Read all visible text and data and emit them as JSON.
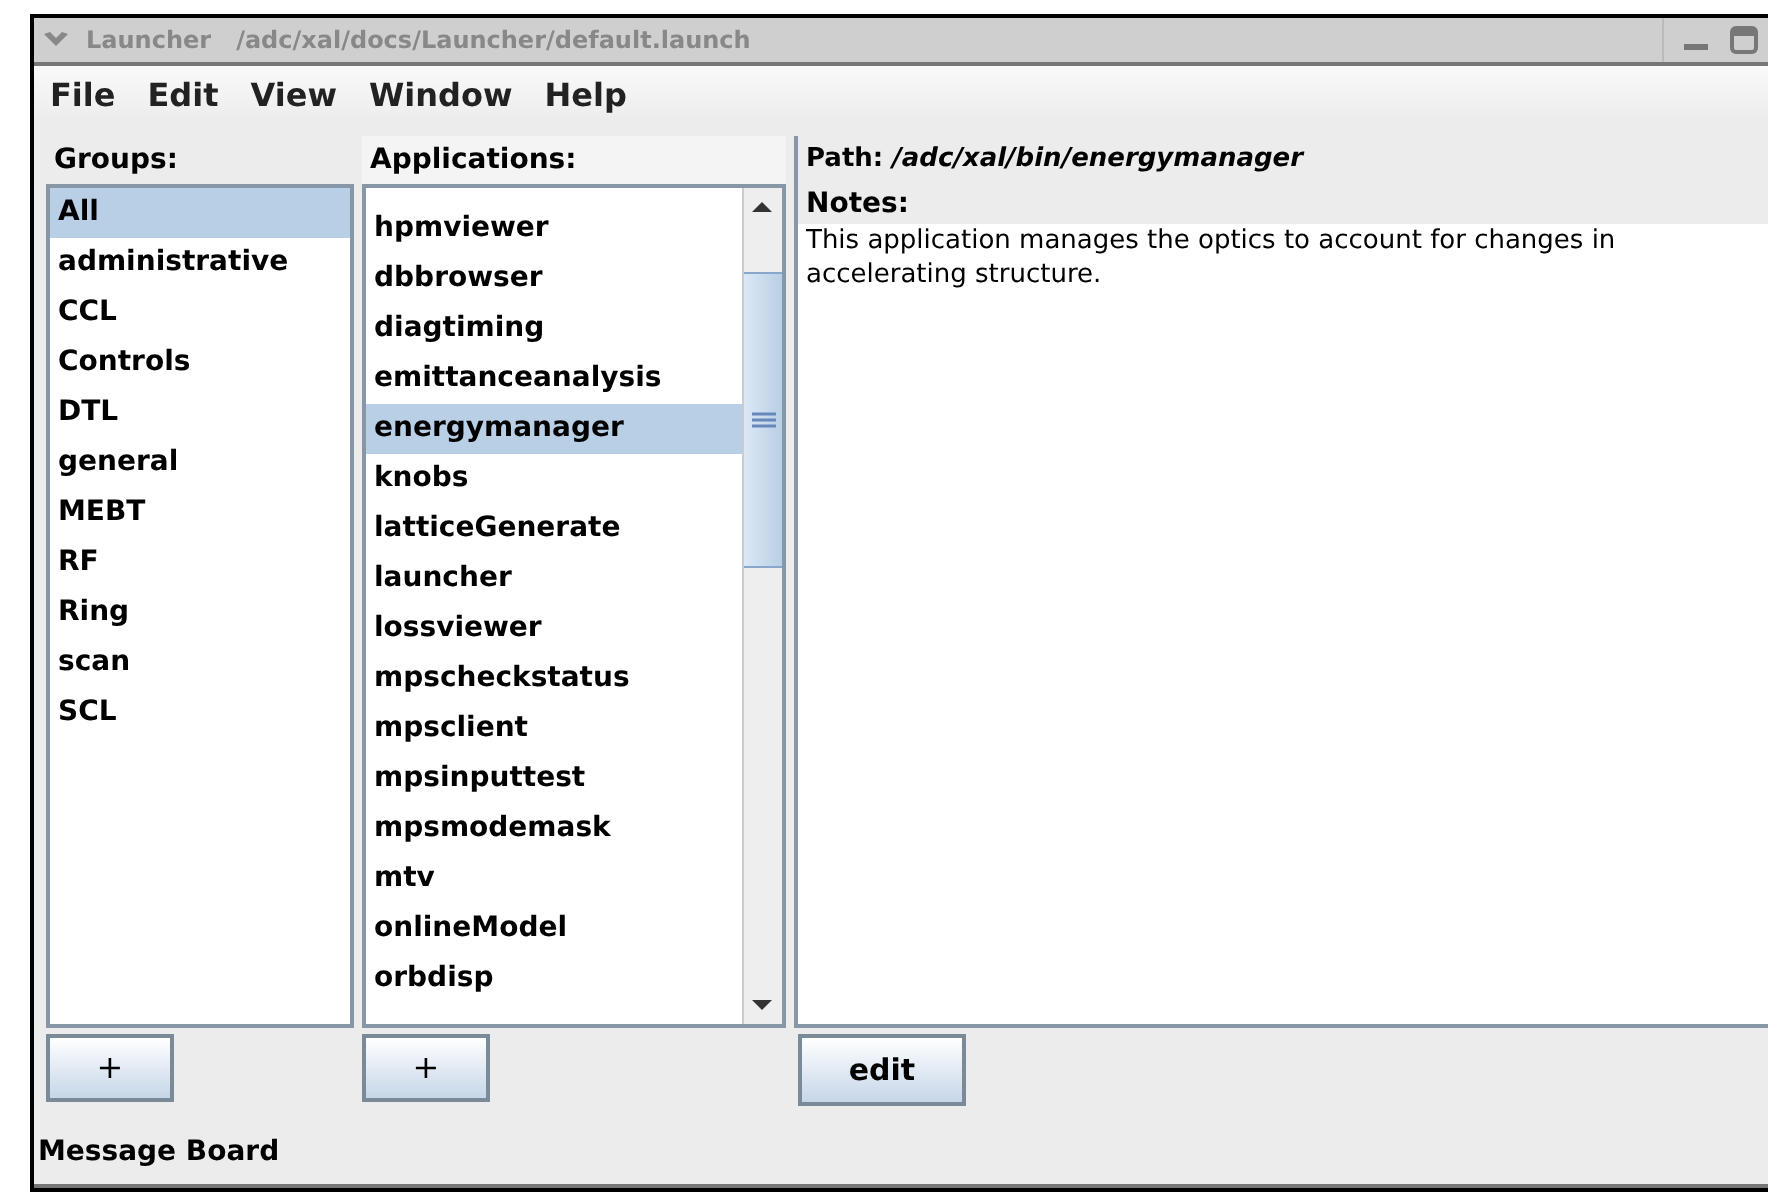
{
  "window": {
    "title": "Launcher   /adc/xal/docs/Launcher/default.launch"
  },
  "menu": [
    "File",
    "Edit",
    "View",
    "Window",
    "Help"
  ],
  "groups": {
    "heading": "Groups:",
    "items": [
      {
        "label": "All",
        "selected": true
      },
      {
        "label": "administrative",
        "selected": false
      },
      {
        "label": "CCL",
        "selected": false
      },
      {
        "label": "Controls",
        "selected": false
      },
      {
        "label": "DTL",
        "selected": false
      },
      {
        "label": "general",
        "selected": false
      },
      {
        "label": "MEBT",
        "selected": false
      },
      {
        "label": "RF",
        "selected": false
      },
      {
        "label": "Ring",
        "selected": false
      },
      {
        "label": "scan",
        "selected": false
      },
      {
        "label": "SCL",
        "selected": false
      }
    ],
    "add_button": "+"
  },
  "applications": {
    "heading": "Applications:",
    "items": [
      {
        "label": "hpmviewer",
        "selected": false
      },
      {
        "label": "dbbrowser",
        "selected": false
      },
      {
        "label": "diagtiming",
        "selected": false
      },
      {
        "label": "emittanceanalysis",
        "selected": false
      },
      {
        "label": "energymanager",
        "selected": true
      },
      {
        "label": "knobs",
        "selected": false
      },
      {
        "label": "latticeGenerate",
        "selected": false
      },
      {
        "label": "launcher",
        "selected": false
      },
      {
        "label": "lossviewer",
        "selected": false
      },
      {
        "label": "mpscheckstatus",
        "selected": false
      },
      {
        "label": "mpsclient",
        "selected": false
      },
      {
        "label": "mpsinputtest",
        "selected": false
      },
      {
        "label": "mpsmodemask",
        "selected": false
      },
      {
        "label": "mtv",
        "selected": false
      },
      {
        "label": "onlineModel",
        "selected": false
      },
      {
        "label": "orbdisp",
        "selected": false
      }
    ],
    "add_button": "+"
  },
  "details": {
    "path": "Path: */adc/xal/bin/energymanager*",
    "notes_label": "Notes:",
    "notes": "This application manages the optics to account for changes in accelerating structure.",
    "edit_button": "edit"
  },
  "status_bar": "Message Board"
}
